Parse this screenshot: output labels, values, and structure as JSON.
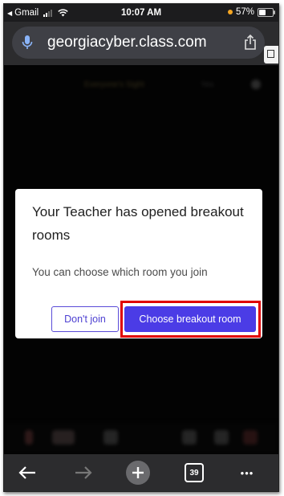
{
  "status_bar": {
    "back_app": "Gmail",
    "time": "10:07 AM",
    "battery": "57%",
    "battery_level": 0.57
  },
  "browser": {
    "url": "georgiacyber.class.com"
  },
  "background": {
    "chip_text": "Everyone's Sight",
    "chip_text2": "Yes"
  },
  "dialog": {
    "title": "Your Teacher has opened breakout rooms",
    "body": "You can choose which room you join",
    "dont_join_label": "Don't join",
    "choose_label": "Choose breakout room"
  },
  "toolbar": {
    "tab_count": "39",
    "more_label": "•••"
  },
  "colors": {
    "accent": "#4b3ce6",
    "highlight": "#e00000",
    "toolbar_bg": "#2c2c2e"
  }
}
